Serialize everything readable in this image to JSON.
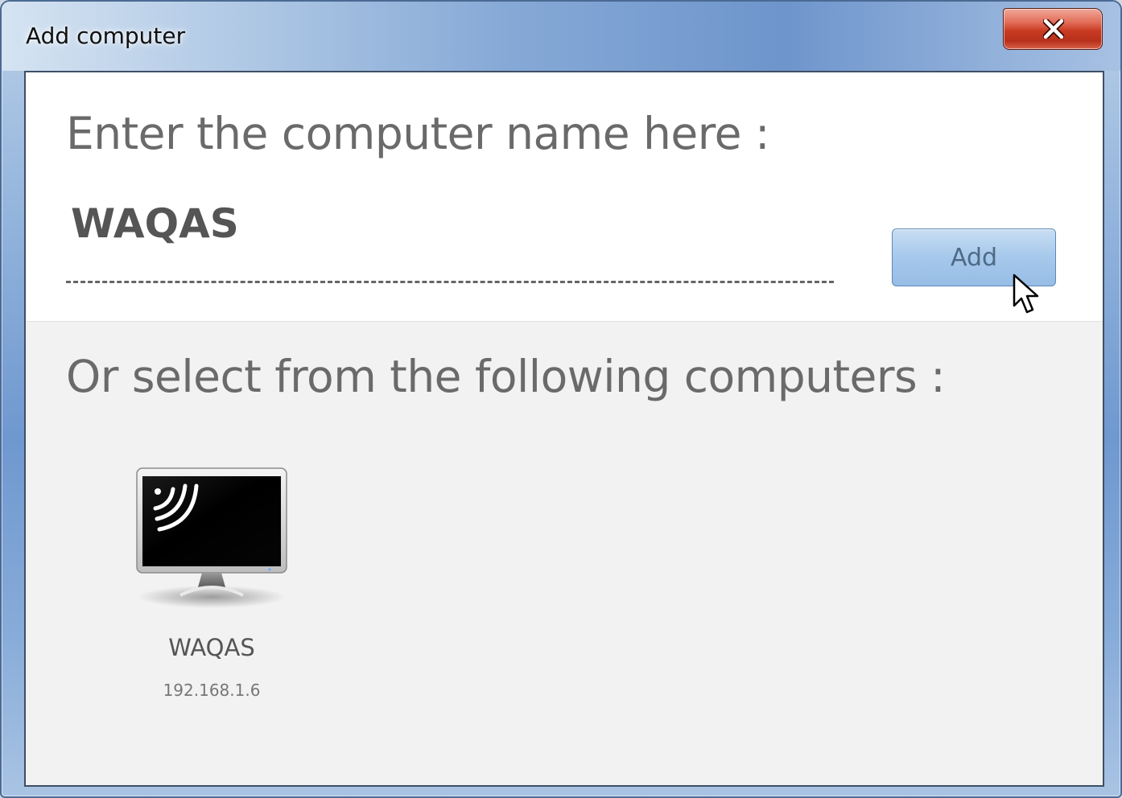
{
  "window": {
    "title": "Add computer",
    "close_icon": "close-icon"
  },
  "entry": {
    "prompt": "Enter the computer name here :",
    "input_value": "WAQAS",
    "add_label": "Add"
  },
  "selection": {
    "prompt": "Or select from the following computers :",
    "computers": [
      {
        "name": "WAQAS",
        "ip": "192.168.1.6",
        "icon": "computer-monitor-icon"
      }
    ]
  },
  "colors": {
    "close_button": "#c83a22",
    "add_button": "#a6c8eb",
    "label_text": "#6a6a6a"
  }
}
